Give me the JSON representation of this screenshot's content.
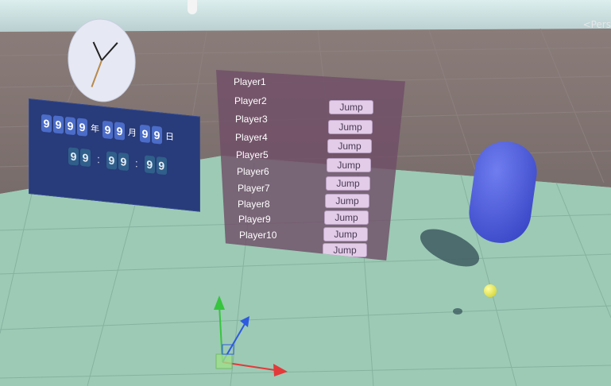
{
  "overlay": {
    "persp_label": "<Pers"
  },
  "clock": {
    "face_color": "#e6e8f4",
    "hand_color": "#222222",
    "second_hand_color": "#b88a4a"
  },
  "date_panel": {
    "year_digits": [
      "9",
      "9",
      "9",
      "9"
    ],
    "year_unit": "年",
    "month_digits": [
      "9",
      "9"
    ],
    "month_unit": "月",
    "day_digits": [
      "9",
      "9"
    ],
    "day_unit": "日",
    "hour_digits": [
      "9",
      "9"
    ],
    "minute_digits": [
      "9",
      "9"
    ],
    "second_digits": [
      "9",
      "9"
    ],
    "separator": ":"
  },
  "player_panel": {
    "players": [
      "Player1",
      "Player2",
      "Player3",
      "Player4",
      "Player5",
      "Player6",
      "Player7",
      "Player8",
      "Player9",
      "Player10"
    ],
    "jump_label": "Jump"
  },
  "colors": {
    "sky": "#cfe6e6",
    "ground": "#9cc9b4",
    "far_floor": "#7a6e6c",
    "capsule": "#4d5ddc",
    "sphere": "#f0f060",
    "axis_x": "#e23a3a",
    "axis_y": "#37c43f",
    "axis_z": "#2e5ae0"
  }
}
